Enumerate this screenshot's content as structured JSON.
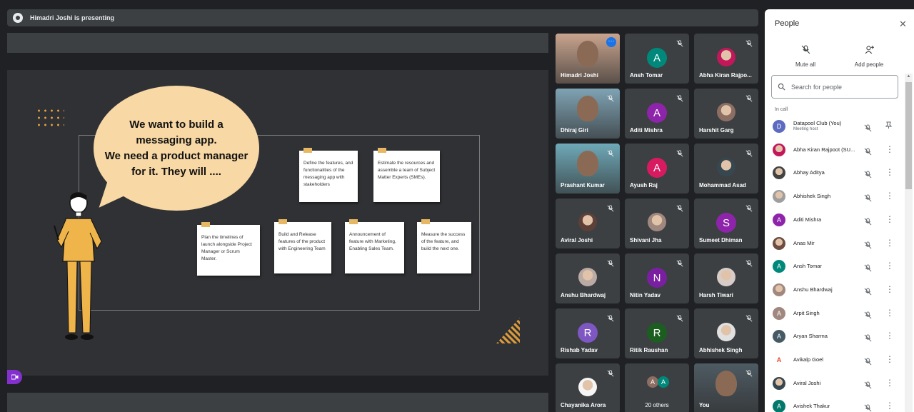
{
  "presenting": {
    "text": "Himadri Joshi is presenting"
  },
  "slide": {
    "bubble_lines": [
      "We want to build a",
      "messaging app.",
      "We need a product manager",
      "for it. They will ...."
    ],
    "notes": [
      "Define the features, and functionalities of the messaging app with stakeholders",
      "Estimate the resources and assemble a team of Subject Matter Experts (SMEs).",
      "Plan the timelines of launch alongside Project Manager or Scrum Master.",
      "Build and Release features of the product with Engineering Team",
      "Announcement of feature with Marketing, Enabling Sales Team.",
      "Measure the success of the feature, and build the next one."
    ]
  },
  "tiles": [
    {
      "name": "Himadri Joshi",
      "kind": "video",
      "color": "#c9a48e"
    },
    {
      "name": "Ansh Tomar",
      "kind": "letter",
      "letter": "A",
      "color": "#00897b"
    },
    {
      "name": "Abha Kiran Rajpo...",
      "kind": "photo",
      "color": "#c2185b"
    },
    {
      "name": "Dhiraj Giri",
      "kind": "video",
      "color": "#7fa3b4"
    },
    {
      "name": "Aditi Mishra",
      "kind": "letter",
      "letter": "A",
      "color": "#8e24aa"
    },
    {
      "name": "Harshit Garg",
      "kind": "photo",
      "color": "#8d6e63"
    },
    {
      "name": "Prashant Kumar",
      "kind": "video",
      "color": "#6fa9b8"
    },
    {
      "name": "Ayush Raj",
      "kind": "letter",
      "letter": "A",
      "color": "#d81b60"
    },
    {
      "name": "Mohammad Asad",
      "kind": "photo",
      "color": "#37474f"
    },
    {
      "name": "Aviral Joshi",
      "kind": "photo",
      "color": "#5d4037"
    },
    {
      "name": "Shivani Jha",
      "kind": "photo",
      "color": "#a1887f"
    },
    {
      "name": "Sumeet Dhiman",
      "kind": "letter",
      "letter": "S",
      "color": "#8e24aa"
    },
    {
      "name": "Anshu Bhardwaj",
      "kind": "photo",
      "color": "#bcaaa4"
    },
    {
      "name": "Nitin Yadav",
      "kind": "letter",
      "letter": "N",
      "color": "#7b1fa2"
    },
    {
      "name": "Harsh Tiwari",
      "kind": "photo",
      "color": "#d7ccc8"
    },
    {
      "name": "Rishab Yadav",
      "kind": "letter",
      "letter": "R",
      "color": "#7e57c2"
    },
    {
      "name": "Ritik Raushan",
      "kind": "letter",
      "letter": "R",
      "color": "#1b5e20"
    },
    {
      "name": "Abhishek Singh",
      "kind": "photo",
      "color": "#e0e0e0"
    },
    {
      "name": "Chayanika Arora",
      "kind": "photo",
      "color": "#f5f5f5"
    },
    {
      "name": "20 others",
      "kind": "others",
      "color": "#00897b"
    },
    {
      "name": "You",
      "kind": "video",
      "color": "#4e5b63"
    }
  ],
  "panel": {
    "title": "People",
    "mute_all": "Mute all",
    "add_people": "Add people",
    "search_placeholder": "Search for people",
    "in_call": "In call",
    "people": [
      {
        "name": "Datapool Club (You)",
        "sub": "Meeting host",
        "letter": "D",
        "color": "#5c6bc0"
      },
      {
        "name": "Abha Kiran Rajpoot (SU...",
        "letter": "",
        "color": "#c2185b"
      },
      {
        "name": "Abhay Aditya",
        "letter": "",
        "color": "#424242"
      },
      {
        "name": "Abhishek Singh",
        "letter": "",
        "color": "#9e9e9e"
      },
      {
        "name": "Aditi Mishra",
        "letter": "A",
        "color": "#8e24aa"
      },
      {
        "name": "Anas Mir",
        "letter": "",
        "color": "#6d4c41"
      },
      {
        "name": "Ansh Tomar",
        "letter": "A",
        "color": "#00897b"
      },
      {
        "name": "Anshu Bhardwaj",
        "letter": "",
        "color": "#a1887f"
      },
      {
        "name": "Arpit Singh",
        "letter": "A",
        "color": "#a1887f"
      },
      {
        "name": "Aryan Sharma",
        "letter": "A",
        "color": "#455a64"
      },
      {
        "name": "Avikalp Goel",
        "letter": "A",
        "color": "#ffffff"
      },
      {
        "name": "Aviral Joshi",
        "letter": "",
        "color": "#37474f"
      },
      {
        "name": "Avishek Thakur",
        "letter": "A",
        "color": "#00796b"
      }
    ]
  }
}
